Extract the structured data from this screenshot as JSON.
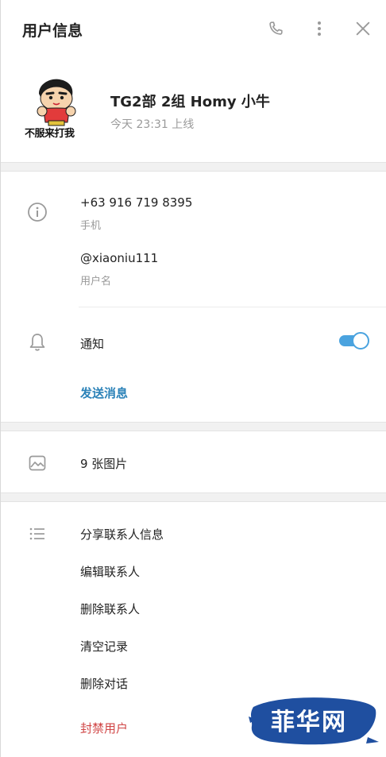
{
  "header": {
    "title": "用户信息",
    "icons": {
      "phone": "phone-icon",
      "more": "more-vertical-icon",
      "close": "close-icon"
    }
  },
  "profile": {
    "avatar_caption": "不服来打我",
    "name": "TG2部 2组 Homy 小牛",
    "status": "今天 23:31 上线"
  },
  "info": {
    "phone_value": "+63 916 719 8395",
    "phone_label": "手机",
    "username_value": "@xiaoniu111",
    "username_label": "用户名"
  },
  "notifications": {
    "label": "通知",
    "enabled": true,
    "send_message": "发送消息"
  },
  "media": {
    "photos_label": "9 张图片"
  },
  "actions": {
    "items": [
      "分享联系人信息",
      "编辑联系人",
      "删除联系人",
      "清空记录",
      "删除对话",
      "封禁用户"
    ]
  },
  "watermark": {
    "text": "菲华网"
  },
  "colors": {
    "accent": "#4aa3df",
    "link": "#2b82b8",
    "danger": "#d04545",
    "watermark_bg": "#1f4fa0"
  }
}
